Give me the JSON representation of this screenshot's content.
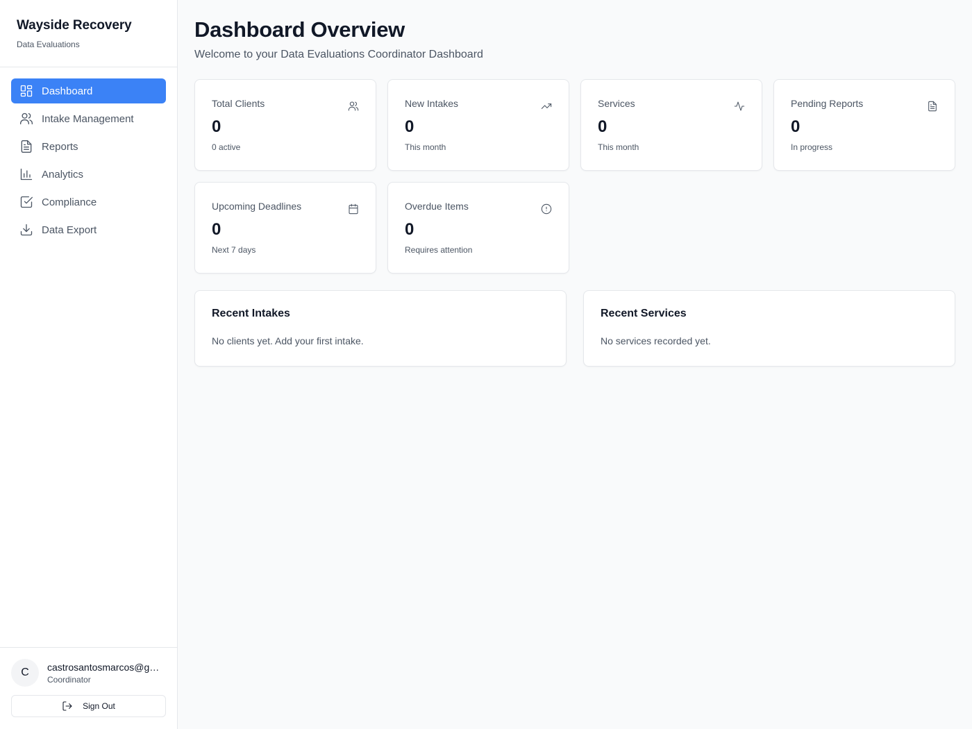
{
  "brand": {
    "title": "Wayside Recovery",
    "subtitle": "Data Evaluations"
  },
  "nav": {
    "items": [
      {
        "label": "Dashboard",
        "icon": "dashboard-icon",
        "active": true
      },
      {
        "label": "Intake Management",
        "icon": "users-icon",
        "active": false
      },
      {
        "label": "Reports",
        "icon": "file-text-icon",
        "active": false
      },
      {
        "label": "Analytics",
        "icon": "bar-chart-icon",
        "active": false
      },
      {
        "label": "Compliance",
        "icon": "check-square-icon",
        "active": false
      },
      {
        "label": "Data Export",
        "icon": "download-icon",
        "active": false
      }
    ]
  },
  "user": {
    "initial": "C",
    "email": "castrosantosmarcos@gmail.com",
    "role": "Coordinator",
    "signout_label": "Sign Out"
  },
  "header": {
    "title": "Dashboard Overview",
    "subtitle": "Welcome to your Data Evaluations Coordinator Dashboard"
  },
  "stats": [
    {
      "label": "Total Clients",
      "value": "0",
      "sub": "0 active",
      "icon": "users-icon"
    },
    {
      "label": "New Intakes",
      "value": "0",
      "sub": "This month",
      "icon": "trending-up-icon"
    },
    {
      "label": "Services",
      "value": "0",
      "sub": "This month",
      "icon": "activity-icon"
    },
    {
      "label": "Pending Reports",
      "value": "0",
      "sub": "In progress",
      "icon": "file-text-icon"
    },
    {
      "label": "Upcoming Deadlines",
      "value": "0",
      "sub": "Next 7 days",
      "icon": "calendar-icon"
    },
    {
      "label": "Overdue Items",
      "value": "0",
      "sub": "Requires attention",
      "icon": "alert-circle-icon"
    }
  ],
  "panels": {
    "recent_intakes": {
      "title": "Recent Intakes",
      "empty": "No clients yet. Add your first intake."
    },
    "recent_services": {
      "title": "Recent Services",
      "empty": "No services recorded yet."
    }
  },
  "colors": {
    "accent": "#3b82f6",
    "text": "#111827",
    "muted": "#4b5563",
    "border": "#e5e7eb",
    "background": "#f9fafb"
  }
}
